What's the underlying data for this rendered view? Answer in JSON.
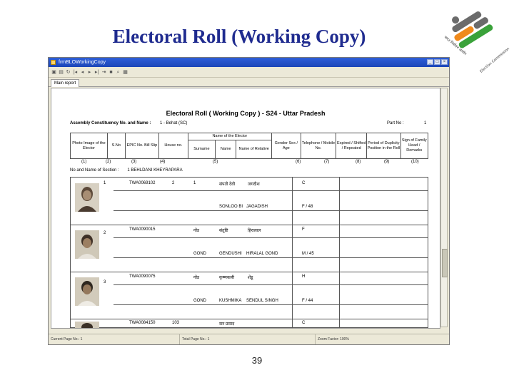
{
  "slide": {
    "title": "Electoral Roll (Working Copy)",
    "page_number": "39"
  },
  "logo": {
    "text": "भारत निर्वाचन आयोग Election Commission of India"
  },
  "window": {
    "title": "frmBLOWorkingCopy",
    "tab_label": "Main report",
    "status": [
      "Current Page No.: 1",
      "Total Page No.: 1",
      "Zoom Factor: 100%"
    ]
  },
  "report": {
    "title": "Electoral Roll ( Working Copy ) - S24 - Uttar Pradesh",
    "assembly_label": "Assembly Constituency No. and Name :",
    "assembly_value": "1 - Behat (SC)",
    "part_label": "Part No :",
    "part_value": "1",
    "headers": [
      "Photo Image of the Elector",
      "S.No",
      "EPIC No. Bill Slip",
      "House no.",
      "Name of the Elector",
      "Surname",
      "Name",
      "Name of Relative",
      "Gender Sex / Age",
      "Telephone / Mobile No.",
      "Expired / Shifted / Repeated",
      "Period of Duplicity Position in the Roll",
      "Sign of Family Head / Remarks"
    ],
    "col_numbers": [
      "(1)",
      "(2)",
      "(3)",
      "(4)",
      "(5)",
      "(6)",
      "(7)",
      "(8)",
      "(9)",
      "(10)"
    ],
    "section_label": "No and Name of Section :",
    "section_value": "1 BEHLDANI KHEYRAPARA",
    "records": [
      {
        "sno": "1",
        "epic": "TWA0069102",
        "house": "2",
        "house2": "1",
        "name_hi": "संपती देवी",
        "rel_hi": "जगदीश",
        "gender": "C",
        "surname": "",
        "name": "SONLOO BI",
        "relative": "JAGADISH",
        "sexage": "F / 48"
      },
      {
        "sno": "2",
        "epic": "TWA0090015",
        "house": "",
        "house2": "गोंड",
        "name_hi": "संतुष्टि",
        "rel_hi": "हिरालाल",
        "gender": "F",
        "surname": "GOND",
        "name": "GENDUSHI",
        "relative": "HIRALAL GOND",
        "sexage": "M / 45"
      },
      {
        "sno": "3",
        "epic": "TWA0090075",
        "house": "",
        "house2": "गोंड",
        "name_hi": "कृष्णकली",
        "rel_hi": "शेंडू",
        "gender": "H",
        "surname": "GOND",
        "name": "KUSHMIKA",
        "relative": "SENDUL SINGH",
        "sexage": "F / 44"
      },
      {
        "sno": "",
        "epic": "TWA0084150",
        "house": "103",
        "house2": "",
        "name_hi": "सन प्रसाद",
        "rel_hi": "",
        "gender": "C",
        "surname": "",
        "name": "",
        "relative": "",
        "sexage": ""
      }
    ]
  },
  "colors": {
    "title": "#1f2b8f",
    "titlebar": "#1c46b8",
    "window_bg": "#ece9d8"
  }
}
